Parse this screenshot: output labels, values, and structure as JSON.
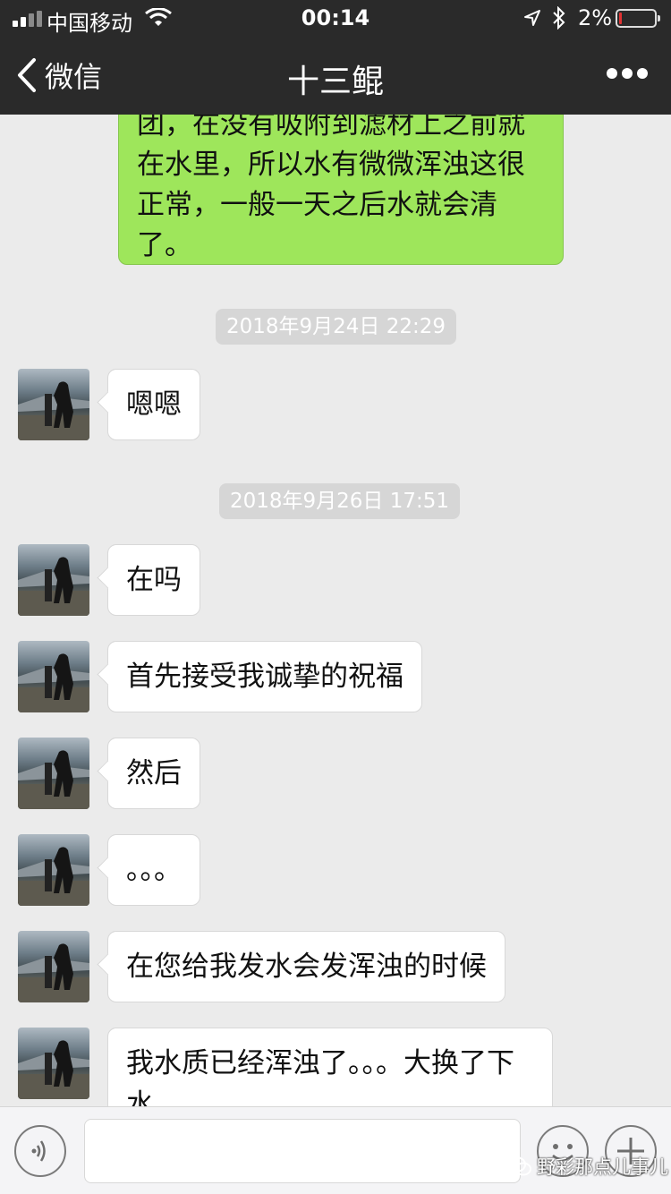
{
  "status_bar": {
    "carrier": "中国移动",
    "time": "00:14",
    "battery_percent": "2%",
    "battery_level": 0.02
  },
  "nav": {
    "back_label": "微信",
    "title": "十三鲲"
  },
  "messages": {
    "outgoing_1": "团，在没有吸附到滤材上之前就在水里，所以水有微微浑浊这很正常，一般一天之后水就会清了。",
    "ts_1": "2018年9月24日 22:29",
    "in_1": "嗯嗯",
    "ts_2": "2018年9月26日 17:51",
    "in_2": "在吗",
    "in_3": "首先接受我诚挚的祝福",
    "in_4": "然后",
    "in_5": "。。。",
    "in_6": "在您给我发水会发浑浊的时候",
    "in_7": "我水质已经浑浊了。。。大换了下水"
  },
  "watermark": "野彩那点儿事儿",
  "colors": {
    "nav_bg": "#2a2a2a",
    "chat_bg": "#ebebeb",
    "outgoing_bubble": "#9ee65b",
    "incoming_bubble": "#ffffff",
    "battery_low": "#e33333"
  },
  "icons": {
    "back": "chevron-left-icon",
    "more": "ellipsis-icon",
    "voice": "voice-icon",
    "emoji": "emoji-icon",
    "plus": "plus-icon"
  }
}
